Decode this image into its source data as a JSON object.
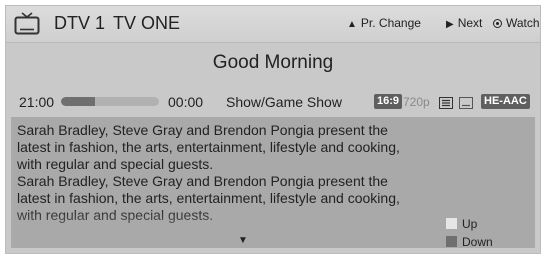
{
  "header": {
    "icon": "tv-icon",
    "channel_number": "DTV 1",
    "channel_name": "TV ONE",
    "hints": {
      "pr_change": "Pr. Change",
      "next": "Next",
      "watch": "Watch"
    }
  },
  "program": {
    "title": "Good Morning",
    "start_time": "21:00",
    "end_time": "00:00",
    "progress": 0.35,
    "genre": "Show/Game Show",
    "aspect": "16:9",
    "resolution": "720p",
    "audio": "HE-AAC",
    "description": "Sarah Bradley, Steve Gray and Brendon Pongia present the\nlatest in fashion, the arts, entertainment, lifestyle and cooking,\nwith regular and special guests.\nSarah Bradley, Steve Gray and Brendon Pongia present the\nlatest in fashion, the arts, entertainment, lifestyle and cooking,\nwith regular and special guests."
  },
  "legend": {
    "up": "Up",
    "down": "Down",
    "up_color": "#e6e6e6",
    "down_color": "#6f6f6f"
  }
}
